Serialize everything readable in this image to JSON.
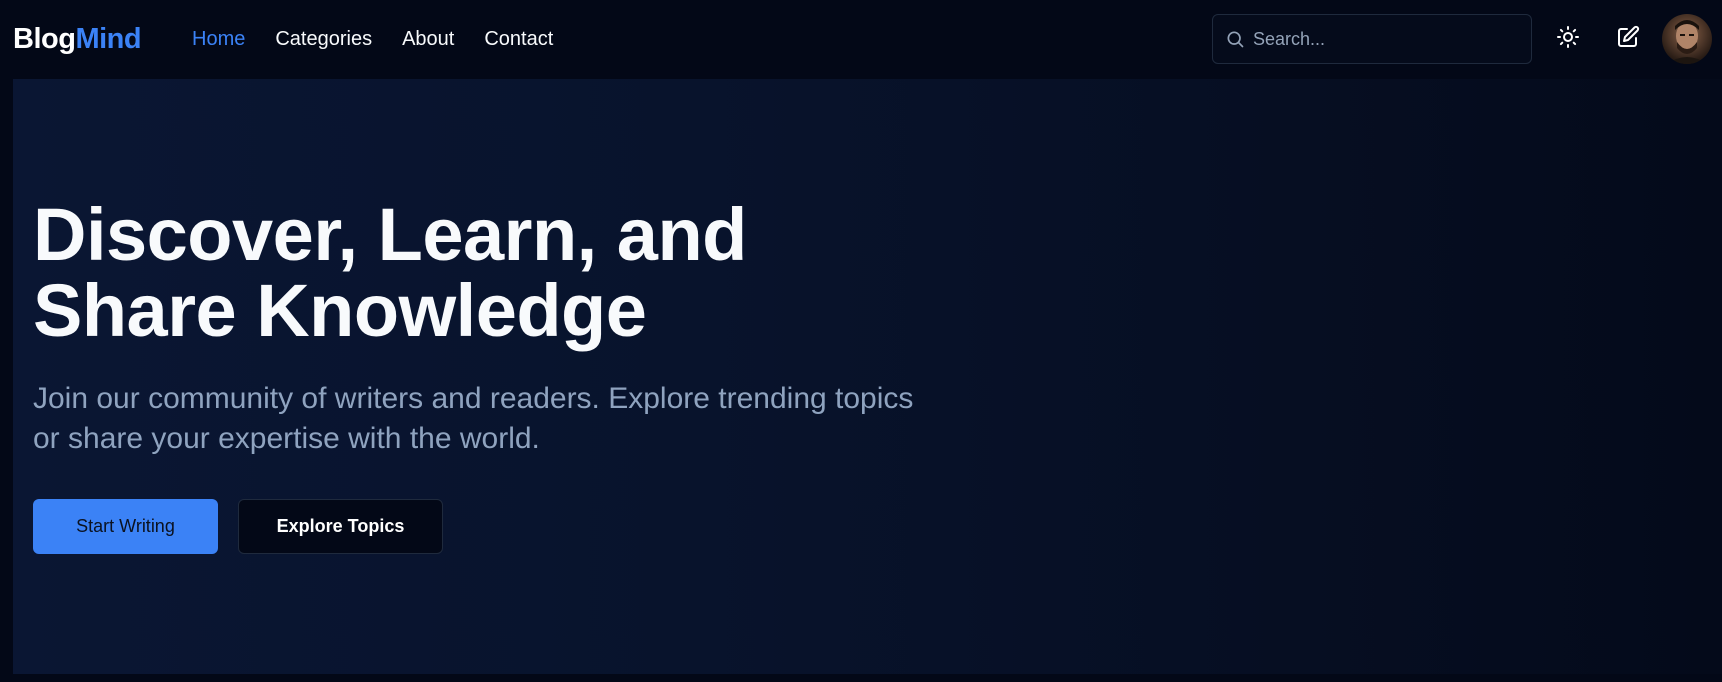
{
  "brand": {
    "part1": "Blog",
    "part2": "Mind"
  },
  "nav": {
    "links": [
      {
        "label": "Home",
        "active": true
      },
      {
        "label": "Categories",
        "active": false
      },
      {
        "label": "About",
        "active": false
      },
      {
        "label": "Contact",
        "active": false
      }
    ]
  },
  "search": {
    "placeholder": "Search...",
    "value": "",
    "icon": "search-icon"
  },
  "toolbar": {
    "theme_icon": "sun-icon",
    "write_icon": "edit-icon",
    "avatar": "user-avatar"
  },
  "hero": {
    "title_line1": "Discover, Learn, and",
    "title_line2": "Share Knowledge",
    "subtitle_line1": "Join our community of writers and readers. Explore trending topics",
    "subtitle_line2": "or share your expertise with the world.",
    "primary_button": "Start Writing",
    "secondary_button": "Explore Topics"
  },
  "colors": {
    "accent": "#3b82f6",
    "background": "#030817",
    "hero_background": "#0a1633",
    "subtitle": "#8fa3bf"
  }
}
